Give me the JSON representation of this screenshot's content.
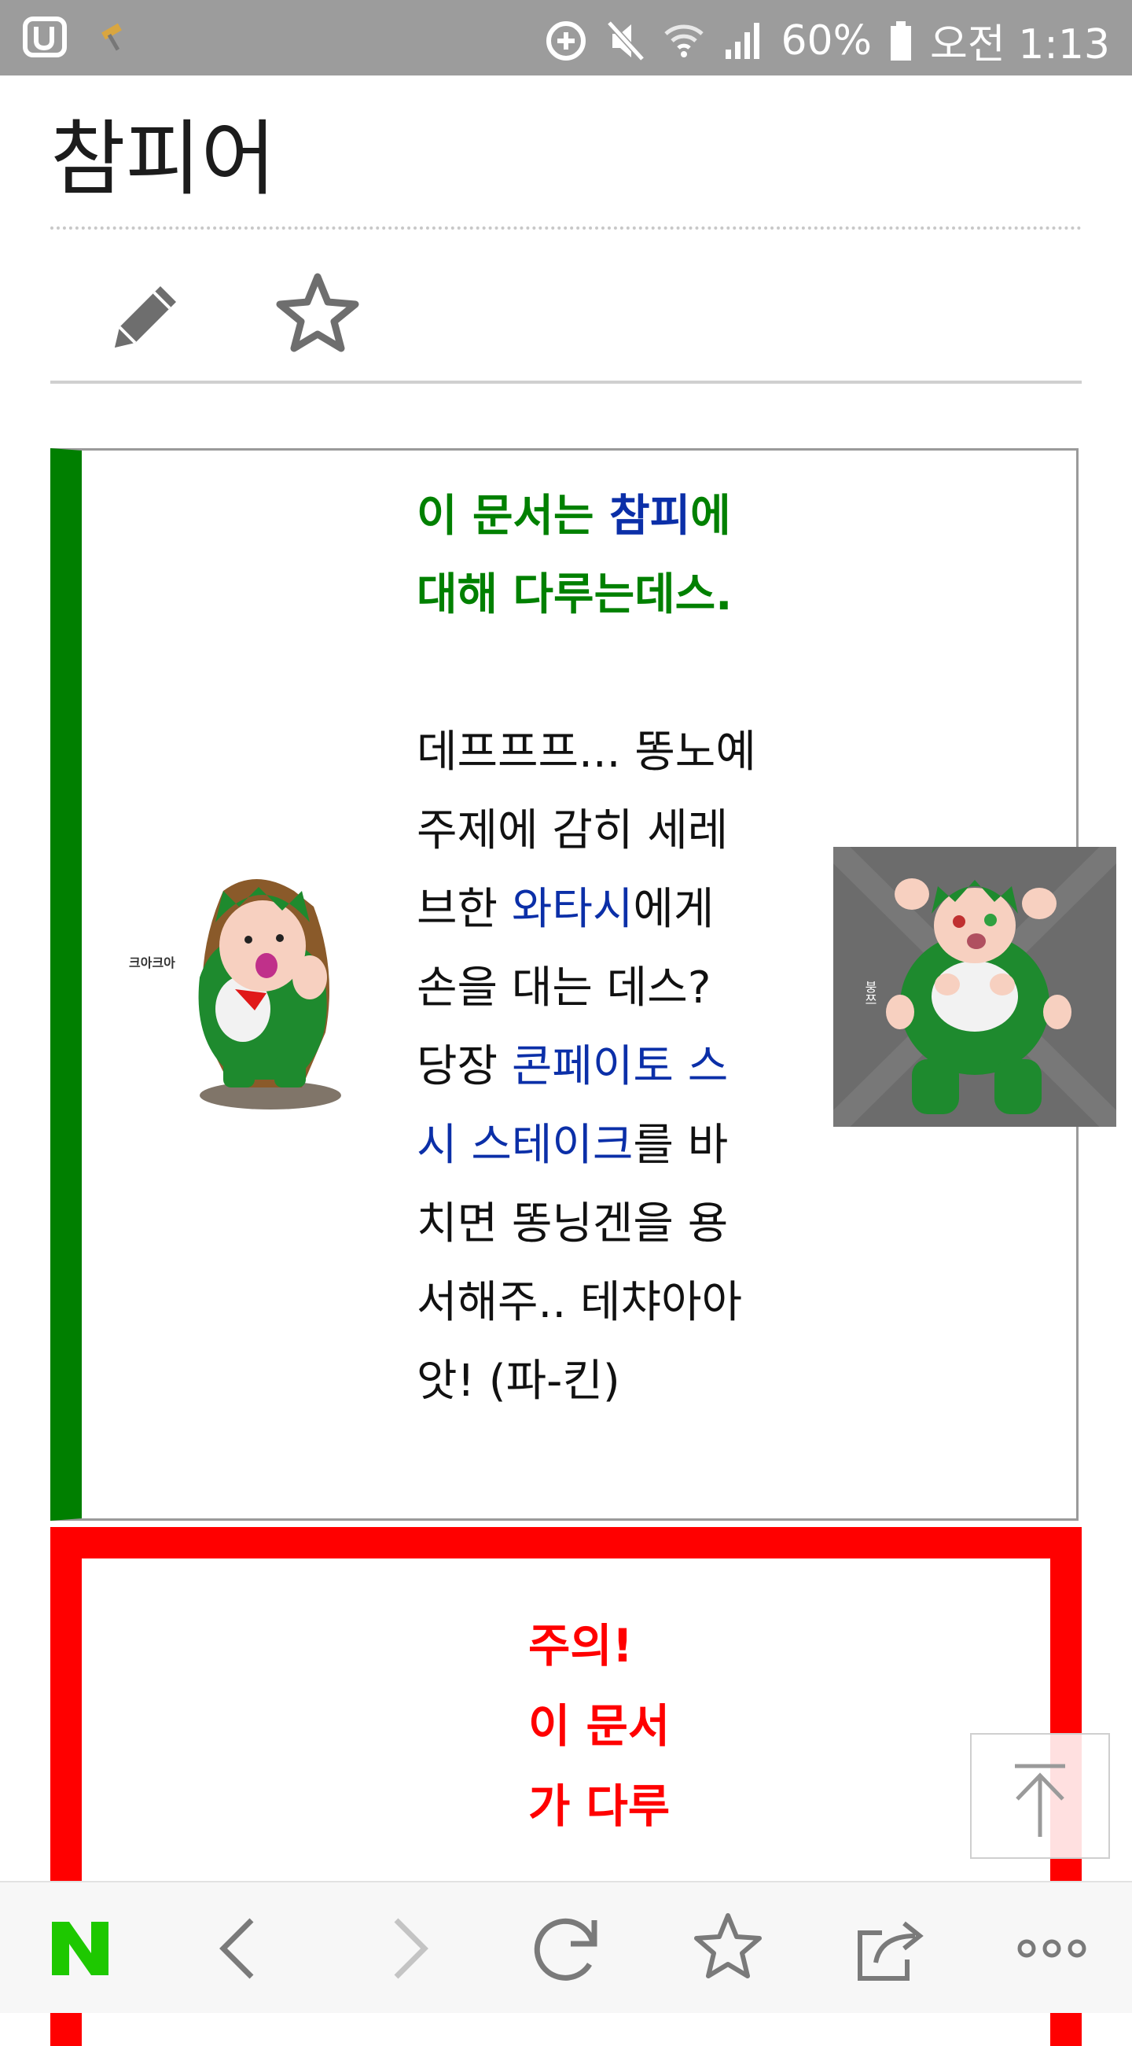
{
  "status_bar": {
    "battery": "60%",
    "time": "오전 1:13",
    "icons": [
      "app-u-icon",
      "hammer-icon",
      "data-saver-icon",
      "mute-icon",
      "wifi-icon",
      "signal-icon",
      "battery-icon"
    ]
  },
  "page": {
    "title": "참피어"
  },
  "actions": {
    "edit_icon": "pencil-icon",
    "favorite_icon": "star-icon"
  },
  "notice_green": {
    "accent_color": "#007f00",
    "heading_1": "이 문서는 ",
    "heading_link": "참피",
    "heading_2": "에 대해 다루는데스.",
    "p1_a": "데프프프... 똥노예 주제에 감히 세레브한 ",
    "p1_link": "와타시",
    "p1_b": "에게 손을 대는 데스?",
    "p2_a": "당장 ",
    "p2_link": "콘페이토 스시 스테이크",
    "p2_b": "를 바치면 똥닝겐을 용서해주.. 테챠아아앗! (파-킨)",
    "image_left_caption": "크아크아",
    "image_right_caption": "붕쯔"
  },
  "notice_red": {
    "accent_color": "#ff0000",
    "text": "주의! 이 문서가 다루"
  },
  "bottom_nav": {
    "home_icon": "naver-n-icon",
    "back_icon": "chevron-left-icon",
    "forward_icon": "chevron-right-icon",
    "reload_icon": "refresh-icon",
    "bookmark_icon": "star-icon",
    "share_icon": "share-icon",
    "menu_icon": "more-dots-icon"
  }
}
